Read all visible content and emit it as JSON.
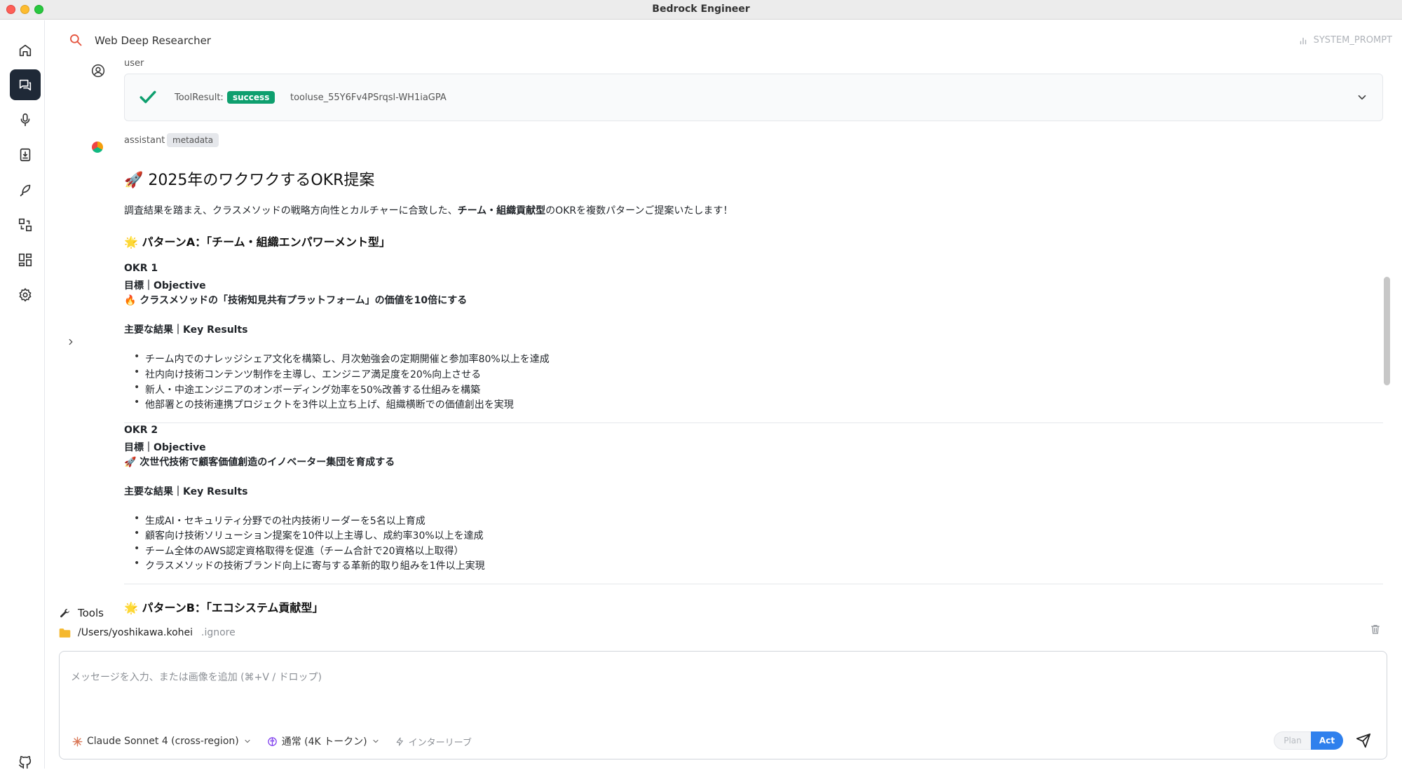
{
  "window": {
    "title": "Bedrock Engineer"
  },
  "topbar": {
    "agent_name": "Web Deep Researcher",
    "system_prompt_label": "SYSTEM_PROMPT"
  },
  "messages": {
    "user": {
      "role": "user",
      "tool_result_label": "ToolResult:",
      "status": "success",
      "tool_id": "tooluse_55Y6Fv4PSrqsl-WH1iaGPA"
    },
    "assistant": {
      "role": "assistant",
      "metadata_label": "metadata",
      "title": "🚀 2025年のワクワクするOKR提案",
      "intro_prefix": "調査結果を踏まえ、クラスメソッドの戦略方向性とカルチャーに合致した、",
      "intro_bold": "チーム・組織貢献型",
      "intro_suffix": "のOKRを複数パターンご提案いたします！",
      "pattern_a": "🌟 パターンA：「チーム・組織エンパワーメント型」",
      "okr1": {
        "label": "OKR 1",
        "objective_label": "目標｜Objective",
        "objective": "🔥 クラスメソッドの「技術知見共有プラットフォーム」の価値を10倍にする",
        "kr_label": "主要な結果｜Key Results",
        "key_results": [
          "チーム内でのナレッジシェア文化を構築し、月次勉強会の定期開催と参加率80%以上を達成",
          "社内向け技術コンテンツ制作を主導し、エンジニア満足度を20%向上させる",
          "新人・中途エンジニアのオンボーディング効率を50%改善する仕組みを構築",
          "他部署との技術連携プロジェクトを3件以上立ち上げ、組織横断での価値創出を実現"
        ]
      },
      "okr2": {
        "label": "OKR 2",
        "objective_label": "目標｜Objective",
        "objective": "🚀 次世代技術で顧客価値創造のイノベーター集団を育成する",
        "kr_label": "主要な結果｜Key Results",
        "key_results": [
          "生成AI・セキュリティ分野での社内技術リーダーを5名以上育成",
          "顧客向け技術ソリューション提案を10件以上主導し、成約率30%以上を達成",
          "チーム全体のAWS認定資格取得を促進（チーム合計で20資格以上取得）",
          "クラスメソッドの技術ブランド向上に寄与する革新的取り組みを1件以上実現"
        ]
      },
      "pattern_b": "🌟 パターンB：「エコシステム貢献型」"
    }
  },
  "tools": {
    "label": "Tools",
    "path": "/Users/yoshikawa.kohei",
    "ignore": ".ignore"
  },
  "composer": {
    "placeholder": "メッセージを入力、または画像を追加 (⌘+V / ドロップ)",
    "model": "Claude Sonnet 4 (cross-region)",
    "thinking": "通常 (4K トークン)",
    "interleave": "インターリーブ",
    "plan": "Plan",
    "act": "Act"
  },
  "colors": {
    "accent": "#2f80ed",
    "success": "#0e9f6e",
    "sidebar_active": "#1f2937",
    "search_icon": "#e5533d"
  }
}
